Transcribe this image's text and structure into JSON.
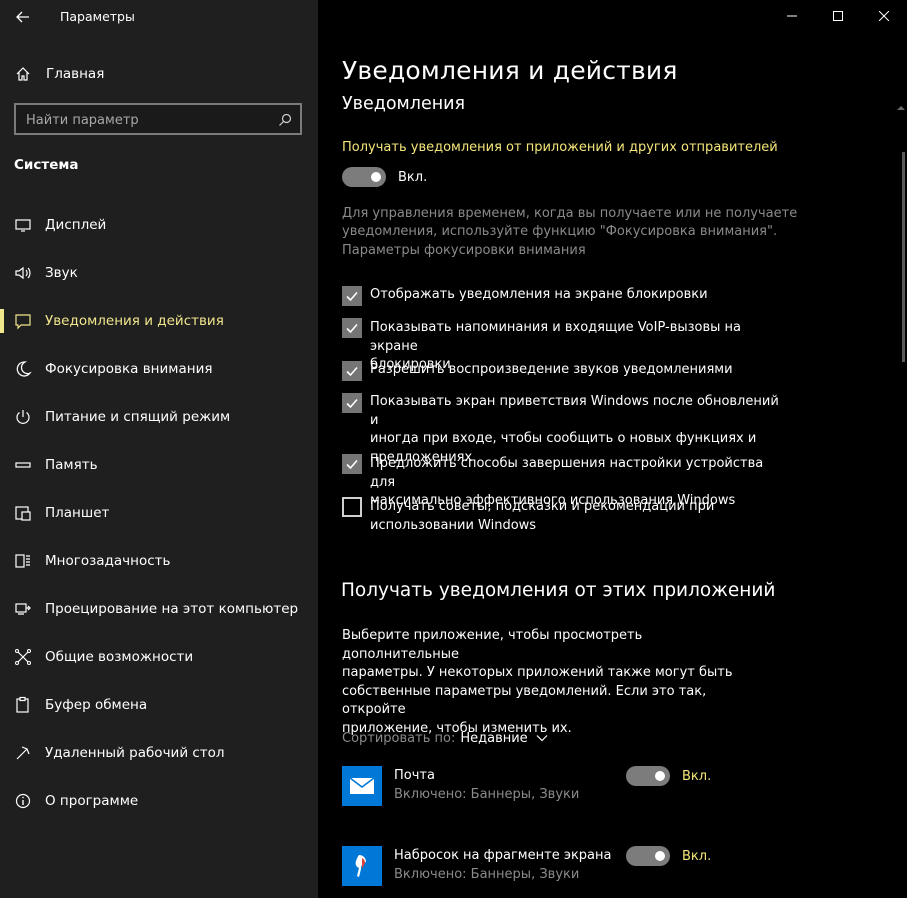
{
  "window": {
    "title": "Параметры",
    "controls": [
      "minimize-icon",
      "maximize-icon",
      "close-icon"
    ]
  },
  "sidebar": {
    "home_label": "Главная",
    "search_placeholder": "Найти параметр",
    "section_title": "Система",
    "items": [
      {
        "label": "Дисплей",
        "icon": "display-icon"
      },
      {
        "label": "Звук",
        "icon": "sound-icon"
      },
      {
        "label": "Уведомления и действия",
        "icon": "notifications-icon",
        "active": true
      },
      {
        "label": "Фокусировка внимания",
        "icon": "moon-icon"
      },
      {
        "label": "Питание и спящий режим",
        "icon": "power-icon"
      },
      {
        "label": "Память",
        "icon": "storage-icon"
      },
      {
        "label": "Планшет",
        "icon": "tablet-icon"
      },
      {
        "label": "Многозадачность",
        "icon": "multitasking-icon"
      },
      {
        "label": "Проецирование на этот компьютер",
        "icon": "projecting-icon"
      },
      {
        "label": "Общие возможности",
        "icon": "shared-experiences-icon"
      },
      {
        "label": "Буфер обмена",
        "icon": "clipboard-icon"
      },
      {
        "label": "Удаленный рабочий стол",
        "icon": "remote-desktop-icon"
      },
      {
        "label": "О программе",
        "icon": "info-icon"
      }
    ]
  },
  "main": {
    "page_title": "Уведомления и действия",
    "notifications_title": "Уведомления",
    "get_notifications_label": "Получать уведомления от приложений и других отправителей",
    "master_toggle_state": "Вкл.",
    "focus_desc_line1": "Для управления временем, когда вы получаете или не получаете",
    "focus_desc_line2": "уведомления, используйте функцию \"Фокусировка внимания\".",
    "focus_link": "Параметры фокусировки внимания",
    "checkboxes": [
      {
        "line1": "Отображать уведомления на экране блокировки",
        "line2": "",
        "line3": "",
        "checked": true
      },
      {
        "line1": "Показывать напоминания и входящие VoIP-вызовы на экране",
        "line2": "блокировки",
        "line3": "",
        "checked": true
      },
      {
        "line1": "Разрешить  воспроизведение звуков уведомлениями",
        "line2": "",
        "line3": "",
        "checked": true
      },
      {
        "line1": "Показывать экран приветствия Windows после обновлений и",
        "line2": "иногда при входе, чтобы сообщить о новых функциях и",
        "line3": "предложениях",
        "checked": true
      },
      {
        "line1": "Предложить способы завершения настройки устройства для",
        "line2": "максимально эффективного использования Windows",
        "line3": "",
        "checked": true
      },
      {
        "line1": "Получать советы, подсказки и рекомендации при",
        "line2": "использовании Windows",
        "line3": "",
        "checked": false
      }
    ],
    "apps_title": "Получать уведомления от этих приложений",
    "apps_desc_line1": "Выберите приложение, чтобы просмотреть дополнительные",
    "apps_desc_line2": "параметры. У некоторых приложений также могут быть",
    "apps_desc_line3": "собственные параметры уведомлений. Если это так, откройте",
    "apps_desc_line4": "приложение, чтобы изменить их.",
    "sort_label": "Сортировать по:",
    "sort_value": "Недавние",
    "apps": [
      {
        "name": "Почта",
        "sub": "Включено: Баннеры, Звуки",
        "state": "Вкл.",
        "icon": "mail-icon"
      },
      {
        "name": "Набросок на фрагменте экрана",
        "sub": "Включено: Баннеры, Звуки",
        "state": "Вкл.",
        "icon": "snip-sketch-icon"
      }
    ]
  },
  "colors": {
    "accent": "#f0e68c",
    "sidebar_bg": "#1f1f1f",
    "main_bg": "#000000",
    "app_icon_bg": "#0078d7"
  }
}
